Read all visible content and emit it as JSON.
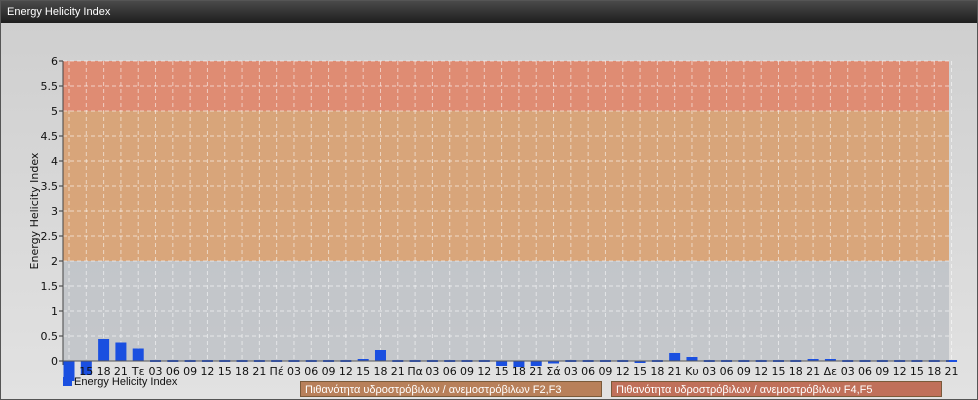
{
  "window": {
    "title": "Energy Helicity Index"
  },
  "colors": {
    "bar": "#1a4fe0",
    "band_low": "#b8bcc2",
    "band_mid": "#d8a070",
    "band_high": "#e08468",
    "legend_mid": "#b8805a",
    "legend_high": "#c0705a"
  },
  "legend": {
    "series": "Energy Helicity Index",
    "band_mid": "Πιθανότητα υδροστρόβιλων / ανεμοστρόβιλων F2,F3",
    "band_high": "Πιθανότητα υδροστρόβιλων / ανεμοστρόβιλων F4,F5"
  },
  "chart_data": {
    "type": "bar",
    "ylabel": "Energy Helicity Index",
    "ylim": [
      -0.5,
      6
    ],
    "yticks": [
      "0",
      "0.5",
      "1",
      "1.5",
      "2",
      "2.5",
      "3",
      "3.5",
      "4",
      "4.5",
      "5",
      "5.5",
      "6"
    ],
    "bands": [
      {
        "from": 2,
        "to": 5
      },
      {
        "from": 5,
        "to": 6
      }
    ],
    "categories": [
      "12",
      "15",
      "18",
      "21",
      "Τε",
      "03",
      "06",
      "09",
      "12",
      "15",
      "18",
      "21",
      "Πέ",
      "03",
      "06",
      "09",
      "12",
      "15",
      "18",
      "21",
      "Πα",
      "03",
      "06",
      "09",
      "12",
      "15",
      "18",
      "21",
      "Σά",
      "03",
      "06",
      "09",
      "12",
      "15",
      "18",
      "21",
      "Κυ",
      "03",
      "06",
      "09",
      "12",
      "15",
      "18",
      "21",
      "Δε",
      "03",
      "06",
      "09",
      "12",
      "15",
      "18",
      "21"
    ],
    "labels": [
      "",
      "15",
      "18",
      "21",
      "Τε",
      "03",
      "06",
      "09",
      "12",
      "15",
      "18",
      "21",
      "Πέ",
      "03",
      "06",
      "09",
      "12",
      "15",
      "18",
      "21",
      "Πα",
      "03",
      "06",
      "09",
      "12",
      "15",
      "18",
      "21",
      "Σά",
      "03",
      "06",
      "09",
      "12",
      "15",
      "18",
      "21",
      "Κυ",
      "03",
      "06",
      "09",
      "12",
      "15",
      "18",
      "21",
      "Δε",
      "03",
      "06",
      "09",
      "12",
      "15",
      "18",
      "21"
    ],
    "values": [
      -0.5,
      -0.28,
      0.44,
      0.37,
      0.25,
      0.02,
      0.02,
      0.02,
      0.02,
      0.02,
      0.02,
      0.02,
      0.03,
      0.02,
      0.02,
      0.02,
      0.02,
      0.04,
      0.22,
      0.02,
      -0.02,
      -0.02,
      -0.02,
      -0.02,
      -0.03,
      -0.1,
      -0.12,
      -0.1,
      -0.05,
      -0.03,
      -0.02,
      -0.02,
      -0.02,
      -0.04,
      -0.02,
      0.16,
      0.08,
      0.02,
      0.02,
      0.02,
      0.02,
      0.02,
      0.02,
      0.04,
      0.04,
      0.02,
      0.02,
      0.02,
      0.02,
      0.02,
      0.02,
      0.02,
      -0.02
    ]
  }
}
